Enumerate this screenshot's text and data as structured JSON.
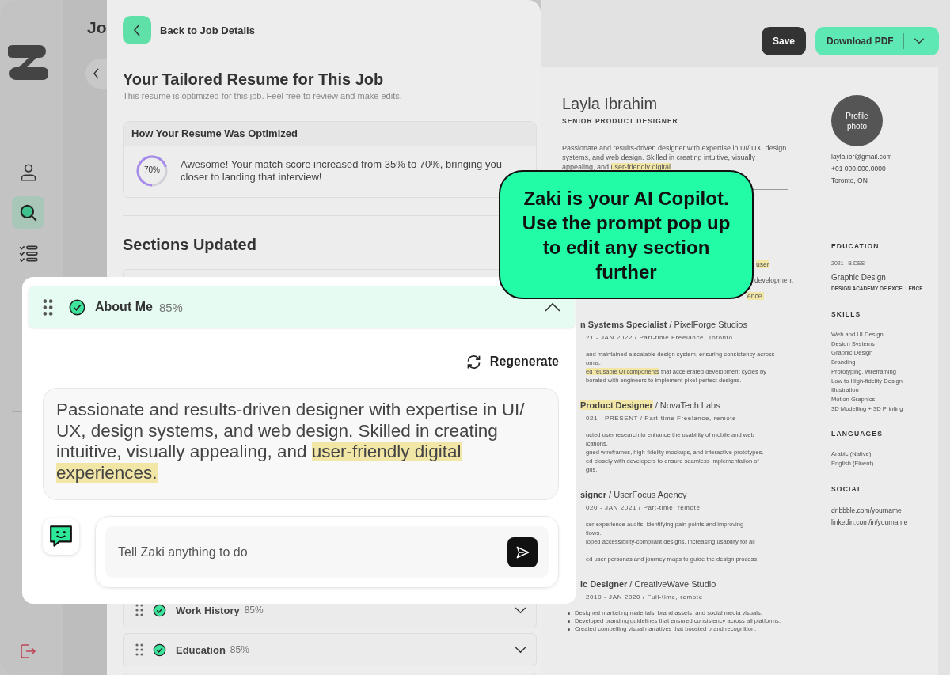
{
  "sidebar": {
    "items": [
      {
        "kind": "profile",
        "selected": false
      },
      {
        "kind": "search",
        "selected": true
      },
      {
        "kind": "checklist",
        "selected": false
      }
    ]
  },
  "background_page": {
    "heading": "Jo"
  },
  "left_panel": {
    "back_label": "Back to Job Details",
    "title": "Your Tailored Resume for This Job",
    "subtitle": "This resume is optimized for this job. Feel free to review and make edits.",
    "optimized_card": {
      "title": "How Your Resume Was Optimized",
      "score_label": "70%",
      "level": 0.7,
      "message": "Awesome! Your match score increased from 35% to 70%, bringing you closer to landing that interview!"
    },
    "sections_title": "Sections Updated",
    "sections": [
      {
        "title": "Work History",
        "score": "85%",
        "done": true,
        "expanded": false
      },
      {
        "title": "Education",
        "score": "85%",
        "done": true,
        "expanded": false
      }
    ]
  },
  "toolbar": {
    "save": "Save",
    "download": "Download PDF"
  },
  "resume": {
    "name": "Layla Ibrahim",
    "role": "SENIOR PRODUCT DESIGNER",
    "summary": "Passionate and results-driven designer with expertise in UI/ UX, design systems, and web design. Skilled in creating intuitive, visually appealing, and ",
    "summary_highlight": "user-friendly digital",
    "fragments": [
      {
        "text": "user",
        "highlight": true
      },
      {
        "text": "development",
        "highlight": false
      },
      {
        "text": "ence.",
        "highlight": true
      }
    ],
    "jobs": [
      {
        "role": "n Systems Specialist",
        "role_highlight": false,
        "company": "/ PixelForge Studios",
        "meta": "21 - JAN 2022 / Part-time Freelance, Toronto",
        "lines": [
          {
            "kind": "fragment",
            "text": "and maintained a scalable design system, ensuring consistency across"
          },
          {
            "kind": "fragment",
            "text": "orms."
          },
          {
            "kind": "fragment",
            "mark": "ed reusable UI components",
            "text": " that accelerated development cycles by"
          },
          {
            "kind": "fragment",
            "text": "borated with engineers to implement pixel-perfect designs."
          }
        ]
      },
      {
        "role": "Product Designer",
        "role_highlight": true,
        "company": "/ NovaTech Labs",
        "meta": "021 - PRESENT / Part-time Freelance, remote",
        "lines": [
          {
            "kind": "fragment",
            "text": "ucted user research to enhance the usability of mobile and web"
          },
          {
            "kind": "fragment",
            "text": "ications."
          },
          {
            "kind": "fragment",
            "text": "gned wireframes, high-fidelity mockups, and interactive prototypes."
          },
          {
            "kind": "fragment",
            "text": "ed closely with developers to ensure seamless implementation of"
          },
          {
            "kind": "fragment",
            "text": "gns."
          }
        ]
      },
      {
        "role": "signer",
        "role_highlight": false,
        "company": "/ UserFocus Agency",
        "meta": "020 - JAN 2021 / Part-time, remote",
        "lines": [
          {
            "kind": "fragment",
            "text": "ser experience audits, identifying pain points and improving"
          },
          {
            "kind": "fragment",
            "text": "flows."
          },
          {
            "kind": "fragment",
            "text": "loped accessibility-compliant designs, increasing usability for all"
          },
          {
            "kind": "fragment",
            "text": "."
          },
          {
            "kind": "fragment",
            "text": "ed user personas and journey maps to guide the design process."
          }
        ]
      },
      {
        "role": "ic Designer",
        "role_highlight": false,
        "company": "/ CreativeWave Studio",
        "meta": "2019 - JAN 2020 / Full-time, remote",
        "lines": [
          {
            "kind": "bullet",
            "text": "Designed marketing materials, brand assets, and social media visuals."
          },
          {
            "kind": "bullet",
            "text": "Developed branding guidelines that ensured consistency across all platforms."
          },
          {
            "kind": "bullet",
            "text": "Created compelling visual narratives that boosted brand recognition."
          }
        ]
      }
    ],
    "photo_label": "Profile photo",
    "email": "layla.ibr@gmail.com",
    "phone": "+01 000.000.0000",
    "location": "Toronto, ON",
    "education_title": "EDUCATION",
    "education_year": "2021 | B.DES",
    "education_field": "Graphic Design",
    "education_school": "DESIGN ACADEMY OF EXCELLENCE",
    "skills_title": "SKILLS",
    "skills": [
      "Web and UI Design",
      "Design Systems",
      "Graphic Design",
      "Branding",
      "Prototyping, wireframing",
      "Low to High-fidelity Design",
      "Illustration",
      "Motion Graphics",
      "3D Modelling + 3D Printing"
    ],
    "languages_title": "LANGUAGES",
    "languages": [
      "Arabic (Native)",
      "English (Fluent)"
    ],
    "social_title": "SOCIAL",
    "social": [
      "dribbble.com/yourname",
      "linkedin.com/in/yourname"
    ]
  },
  "section_popup": {
    "title": "About Me",
    "score": "85%",
    "done": true,
    "expanded": true,
    "regenerate": "Regenerate",
    "text": "Passionate and results-driven designer with expertise in UI/ UX, design systems, and web design. Skilled in creating intuitive, visually appealing, and ",
    "highlight": "user-friendly digital experiences.",
    "prompt_placeholder": "Tell Zaki anything to do"
  },
  "callout": "Zaki is your AI Copilot. Use the prompt pop up to edit any section further"
}
